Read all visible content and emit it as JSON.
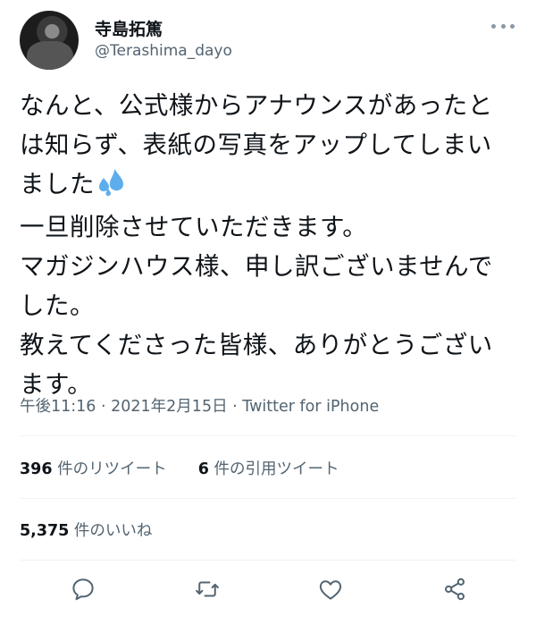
{
  "user": {
    "display_name": "寺島拓篤",
    "handle": "@Terashima_dayo"
  },
  "tweet": {
    "text_before_emoji": "なんと、公式様からアナウンスがあったとは知らず、表紙の写真をアップしてしまいました",
    "emoji": "sweat-droplets",
    "text_after_emoji": "\n一旦削除させていただきます。\nマガジンハウス様、申し訳ございませんでした。\n教えてくださった皆様、ありがとうございます。"
  },
  "meta": {
    "time": "午後11:16",
    "sep1": " · ",
    "date": "2021年2月15日",
    "sep2": " · ",
    "source": "Twitter for iPhone"
  },
  "stats": {
    "retweets_count": "396",
    "retweets_label": " 件のリツイート",
    "quotes_count": "6",
    "quotes_label": " 件の引用ツイート",
    "likes_count": "5,375",
    "likes_label": " 件のいいね"
  },
  "actions": [
    {
      "icon": "reply-icon"
    },
    {
      "icon": "retweet-icon"
    },
    {
      "icon": "like-icon"
    },
    {
      "icon": "share-icon"
    }
  ],
  "colors": {
    "text": "#0f1419",
    "secondary": "#536471",
    "divider": "#eff3f4",
    "emoji_blue": "#5dadec"
  }
}
